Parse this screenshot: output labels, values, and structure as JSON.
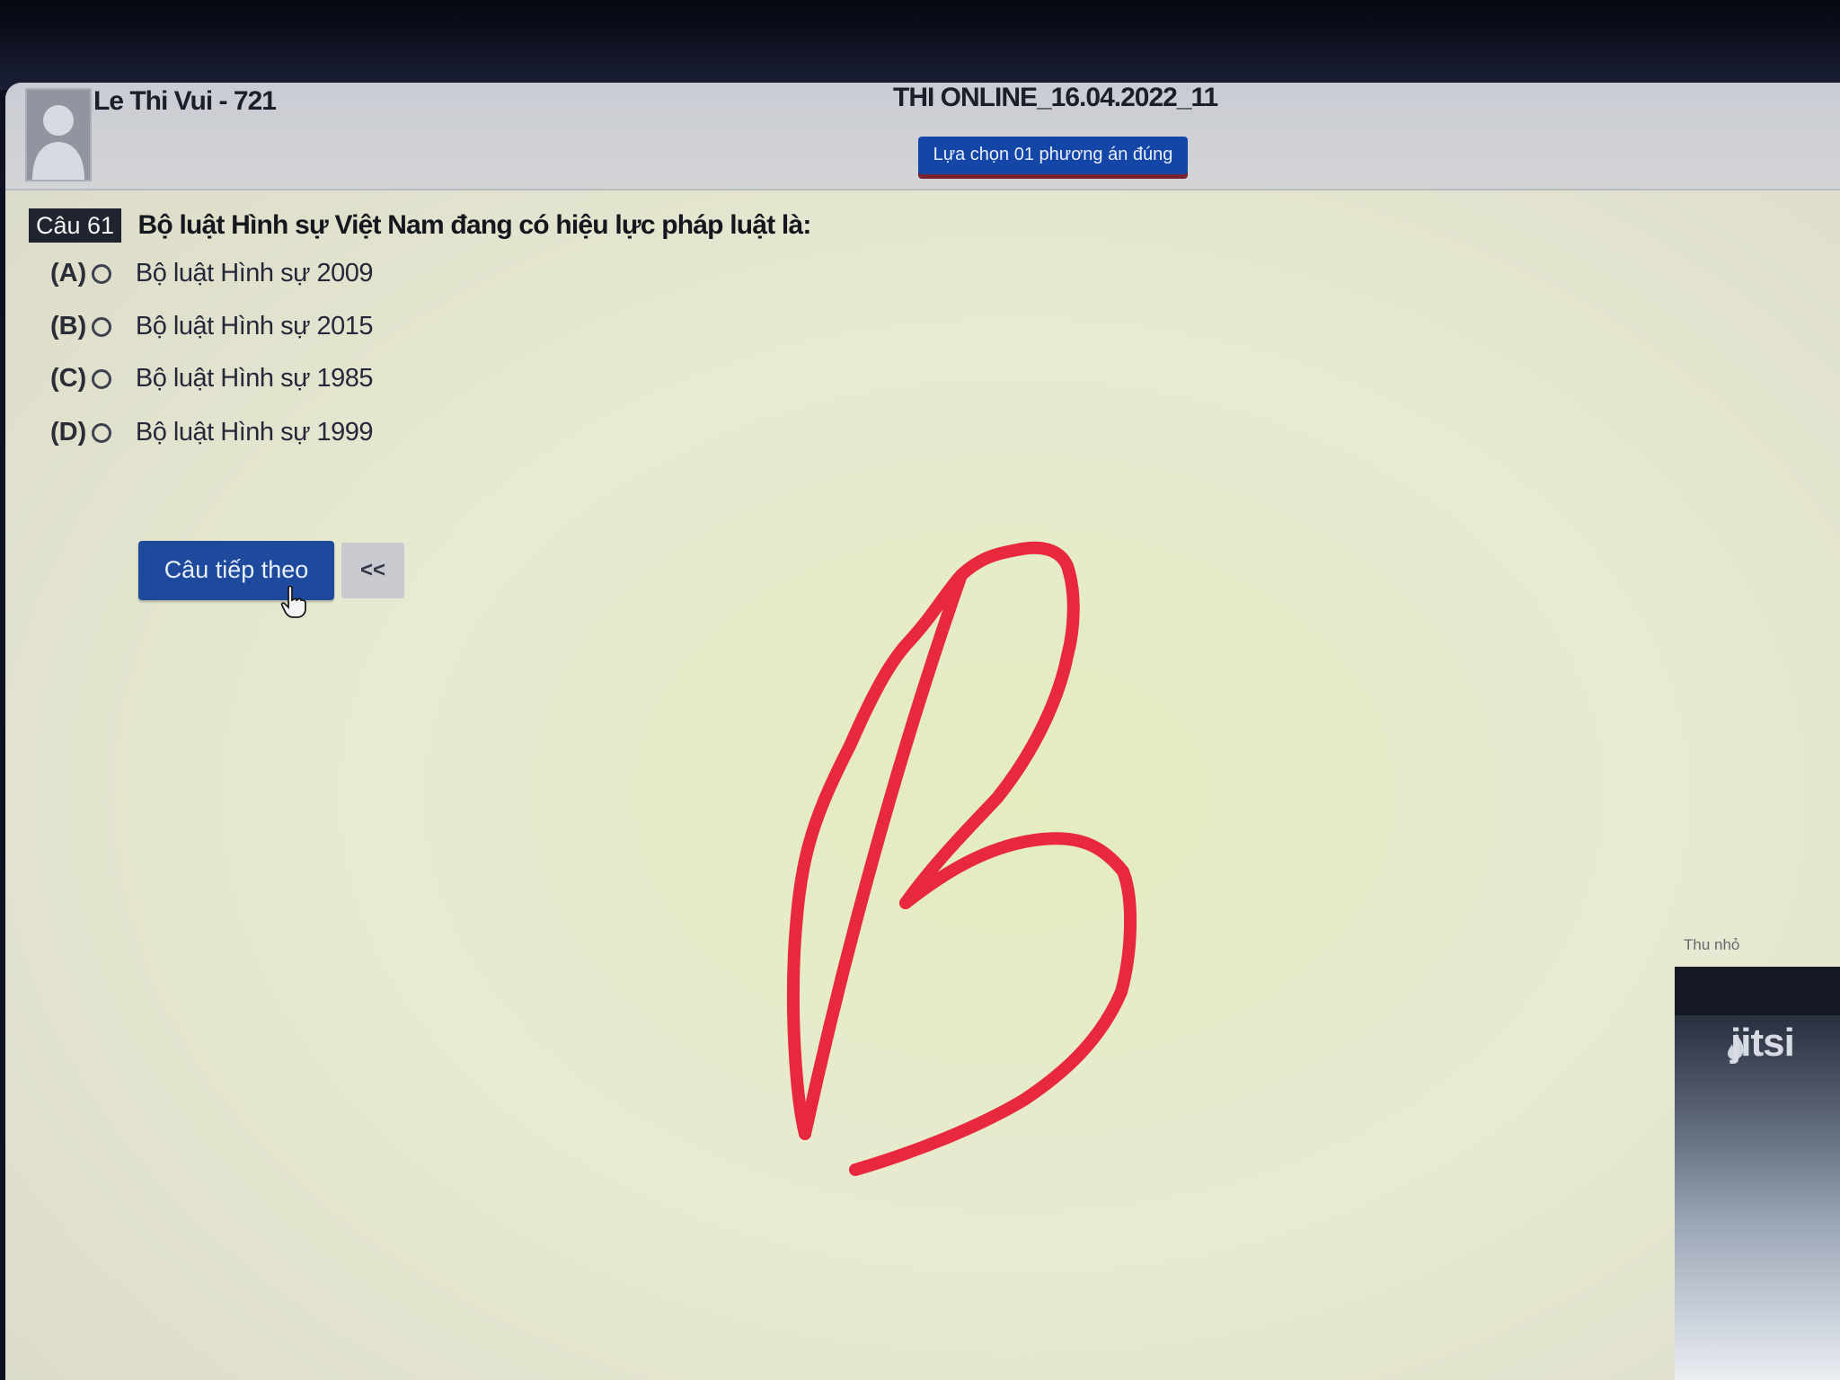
{
  "header": {
    "user_name": "Le Thi Vui - 721",
    "exam_title": "THI ONLINE_16.04.2022_11",
    "instruction": "Lựa chọn 01 phương án đúng"
  },
  "question": {
    "number_label": "Câu 61",
    "text": "Bộ luật Hình sự Việt Nam đang có hiệu lực pháp luật là:",
    "options": [
      {
        "letter": "(A)",
        "text": "Bộ luật Hình sự 2009"
      },
      {
        "letter": "(B)",
        "text": "Bộ luật Hình sự 2015"
      },
      {
        "letter": "(C)",
        "text": "Bộ luật Hình sự 1985"
      },
      {
        "letter": "(D)",
        "text": "Bộ luật Hình sự 1999"
      }
    ]
  },
  "navigation": {
    "next_label": "Câu tiếp theo",
    "back_label": "<<"
  },
  "video": {
    "minimize_label": "Thu nhỏ",
    "logo_text": "jitsi"
  },
  "annotation": {
    "handwritten_letter": "B",
    "color": "#e8283c"
  },
  "icons": [
    "avatar-placeholder-icon",
    "hand-cursor-icon",
    "jitsi-flame-icon"
  ],
  "colors": {
    "primary_button": "#1d4a9c",
    "badge": "#1446a8",
    "header_bg": "#c9ccd3"
  }
}
